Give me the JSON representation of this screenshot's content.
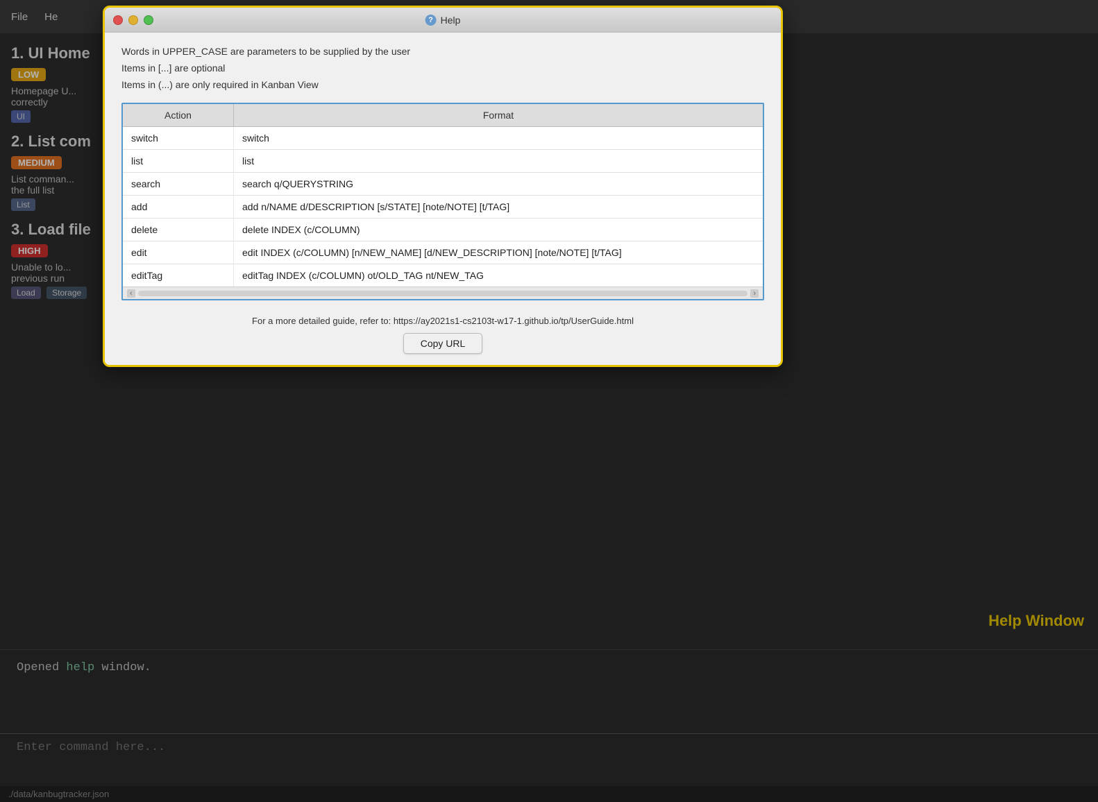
{
  "app": {
    "menu_items": [
      "File",
      "He"
    ],
    "file_path": "./data/kanbugtracker.json"
  },
  "background": {
    "tasks": [
      {
        "id": "1",
        "title": "1. UI Home",
        "priority": "LOW",
        "description": "Homepage U... correctly",
        "tags": [
          "UI"
        ]
      },
      {
        "id": "2",
        "title": "2. List com",
        "priority": "MEDIUM",
        "description": "List comman... the full list",
        "tags": [
          "List"
        ]
      },
      {
        "id": "3",
        "title": "3. Load file",
        "priority": "HIGH",
        "description": "Unable to lo... previous run",
        "tags": [
          "Load",
          "Storage"
        ]
      }
    ]
  },
  "terminal": {
    "output_text": "Opened help window.",
    "output_keyword": "help",
    "input_placeholder": "Enter command here..."
  },
  "help_window_label": "Help Window",
  "dialog": {
    "title": "Help",
    "instructions": [
      "Words in UPPER_CASE are parameters to be supplied by the user",
      "Items in [...] are optional",
      "Items in (...) are only required in Kanban View"
    ],
    "table": {
      "headers": [
        "Action",
        "Format"
      ],
      "rows": [
        {
          "action": "switch",
          "format": "switch"
        },
        {
          "action": "list",
          "format": "list"
        },
        {
          "action": "search",
          "format": "search q/QUERYSTRING"
        },
        {
          "action": "add",
          "format": "add n/NAME d/DESCRIPTION [s/STATE] [note/NOTE] [t/TAG]"
        },
        {
          "action": "delete",
          "format": "delete INDEX (c/COLUMN)"
        },
        {
          "action": "edit",
          "format": "edit INDEX (c/COLUMN) [n/NEW_NAME] [d/NEW_DESCRIPTION] [note/NOTE] [t/TAG]"
        },
        {
          "action": "editTag",
          "format": "editTag INDEX (c/COLUMN) ot/OLD_TAG nt/NEW_TAG"
        }
      ]
    },
    "guide_text": "For a more detailed guide, refer to: https://ay2021s1-cs2103t-w17-1.github.io/tp/UserGuide.html",
    "copy_url_label": "Copy URL"
  }
}
